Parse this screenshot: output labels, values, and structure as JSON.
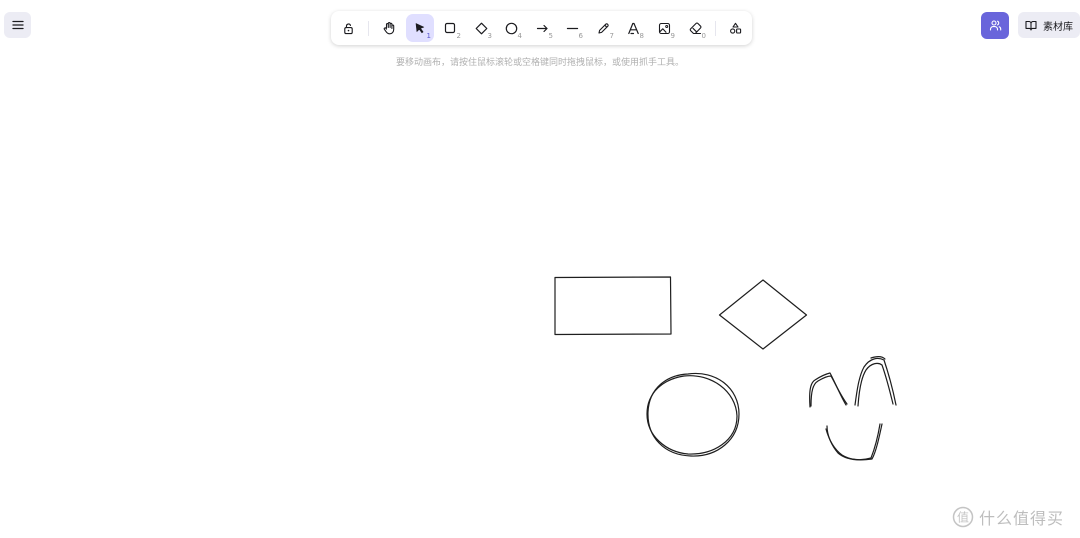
{
  "menu": {
    "icon": "hamburger-menu-icon"
  },
  "toolbar": {
    "tools": [
      {
        "id": "lock",
        "icon": "unlock-icon",
        "shortcut": ""
      },
      {
        "id": "hand",
        "icon": "hand-icon",
        "shortcut": ""
      },
      {
        "id": "selection",
        "icon": "pointer-icon",
        "shortcut": "1",
        "active": true
      },
      {
        "id": "rectangle",
        "icon": "square-icon",
        "shortcut": "2"
      },
      {
        "id": "diamond",
        "icon": "diamond-icon",
        "shortcut": "3"
      },
      {
        "id": "ellipse",
        "icon": "circle-icon",
        "shortcut": "4"
      },
      {
        "id": "arrow",
        "icon": "arrow-right-icon",
        "shortcut": "5"
      },
      {
        "id": "line",
        "icon": "line-icon",
        "shortcut": "6"
      },
      {
        "id": "draw",
        "icon": "pencil-icon",
        "shortcut": "7"
      },
      {
        "id": "text",
        "icon": "text-icon",
        "shortcut": "8"
      },
      {
        "id": "image",
        "icon": "image-icon",
        "shortcut": "9"
      },
      {
        "id": "eraser",
        "icon": "eraser-icon",
        "shortcut": "0"
      },
      {
        "id": "extra",
        "icon": "shapes-icon",
        "shortcut": ""
      }
    ],
    "active_color": "#e0dfff"
  },
  "hint": "要移动画布，请按住鼠标滚轮或空格键同时拖拽鼠标，或使用抓手工具。",
  "collab": {
    "icon": "users-icon",
    "color": "#6965db"
  },
  "library": {
    "icon": "book-icon",
    "label": "素材库"
  },
  "watermark": {
    "icon": "zhi-logo-icon",
    "text": "什么值得买"
  },
  "canvas_shapes": [
    "rectangle",
    "diamond",
    "ellipse",
    "freehand"
  ]
}
